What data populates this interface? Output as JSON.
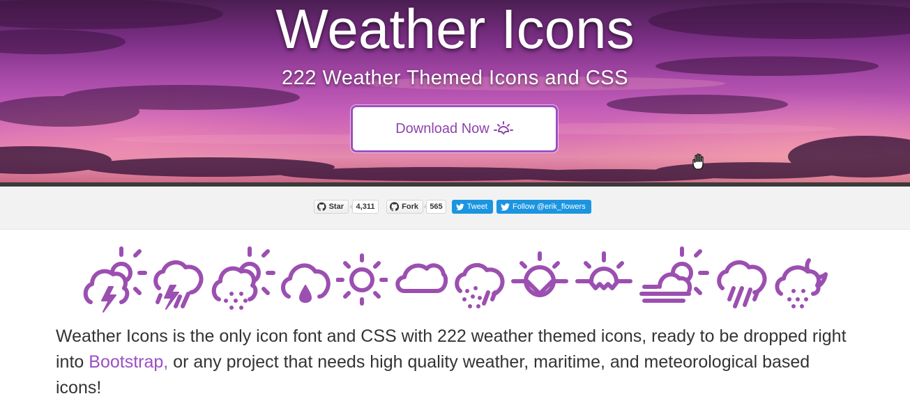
{
  "hero": {
    "title": "Weather Icons",
    "subtitle": "222 Weather Themed Icons and CSS",
    "download_label": "Download Now",
    "download_icon": "sunrise-icon"
  },
  "social": {
    "star_label": "Star",
    "star_count": "4,311",
    "fork_label": "Fork",
    "fork_count": "565",
    "tweet_label": "Tweet",
    "follow_label": "Follow @erik_flowers"
  },
  "icons": [
    "day-thunderstorm-icon",
    "thunderstorm-icon",
    "day-sleet-icon",
    "raindrop-cloud-icon",
    "day-sunny-icon",
    "cloudy-icon",
    "rain-mix-icon",
    "sunrise-icon",
    "sunset-icon",
    "day-fog-icon",
    "rain-icon",
    "night-sleet-icon"
  ],
  "intro": {
    "text_before": "Weather Icons is the only icon font and CSS with 222 weather themed icons, ready to be dropped right into ",
    "link": "Bootstrap,",
    "text_after": " or any project that needs high quality weather, maritime, and meteorological based icons!"
  },
  "colors": {
    "accent": "#9b4fc4",
    "icon_purple": "#9b4fb0",
    "twitter_blue": "#1b95e0"
  }
}
